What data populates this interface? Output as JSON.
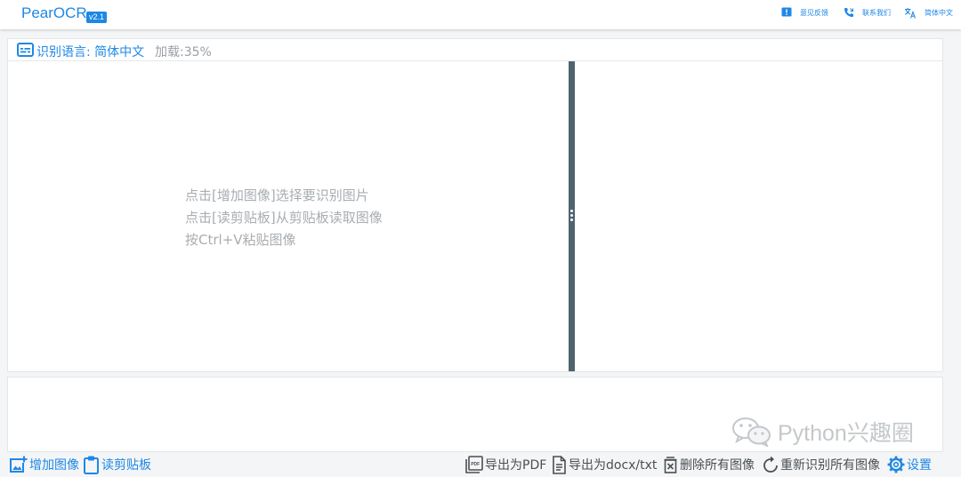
{
  "header": {
    "app_title": "PearOCR",
    "version": "v2.1",
    "nav": {
      "feedback": "意见反馈",
      "contact": "联系我们",
      "language": "简体中文"
    }
  },
  "recognition": {
    "language_label": "识别语言: 简体中文",
    "load_status": "加载:35%"
  },
  "image_pane": {
    "hints": [
      "点击[增加图像]选择要识别图片",
      "点击[读剪贴板]从剪贴板读取图像",
      "按Ctrl+V粘贴图像"
    ]
  },
  "watermark": "Python兴趣圈",
  "toolbar": {
    "add_image": "增加图像",
    "read_clipboard": "读剪贴板",
    "export_pdf": "导出为PDF",
    "export_docx": "导出为docx/txt",
    "delete_all": "删除所有图像",
    "rerecognize_all": "重新识别所有图像",
    "settings": "设置"
  },
  "colors": {
    "accent": "#1e88e5",
    "splitter": "#4f636f",
    "hint_text": "#a8adb1",
    "muted_text": "#9aa0a5",
    "toolbar_gray": "#4a4f53"
  },
  "icons": {
    "feedback": "feedback-icon",
    "contact": "phone-icon",
    "language": "translate-icon",
    "recognition_language": "subtitles-icon",
    "add_image": "add-photo-icon",
    "read_clipboard": "clipboard-icon",
    "export_pdf": "pdf-icon",
    "export_docx": "document-icon",
    "delete_all": "delete-box-icon",
    "rerecognize_all": "refresh-icon",
    "settings": "gear-icon",
    "watermark": "wechat-icon"
  }
}
